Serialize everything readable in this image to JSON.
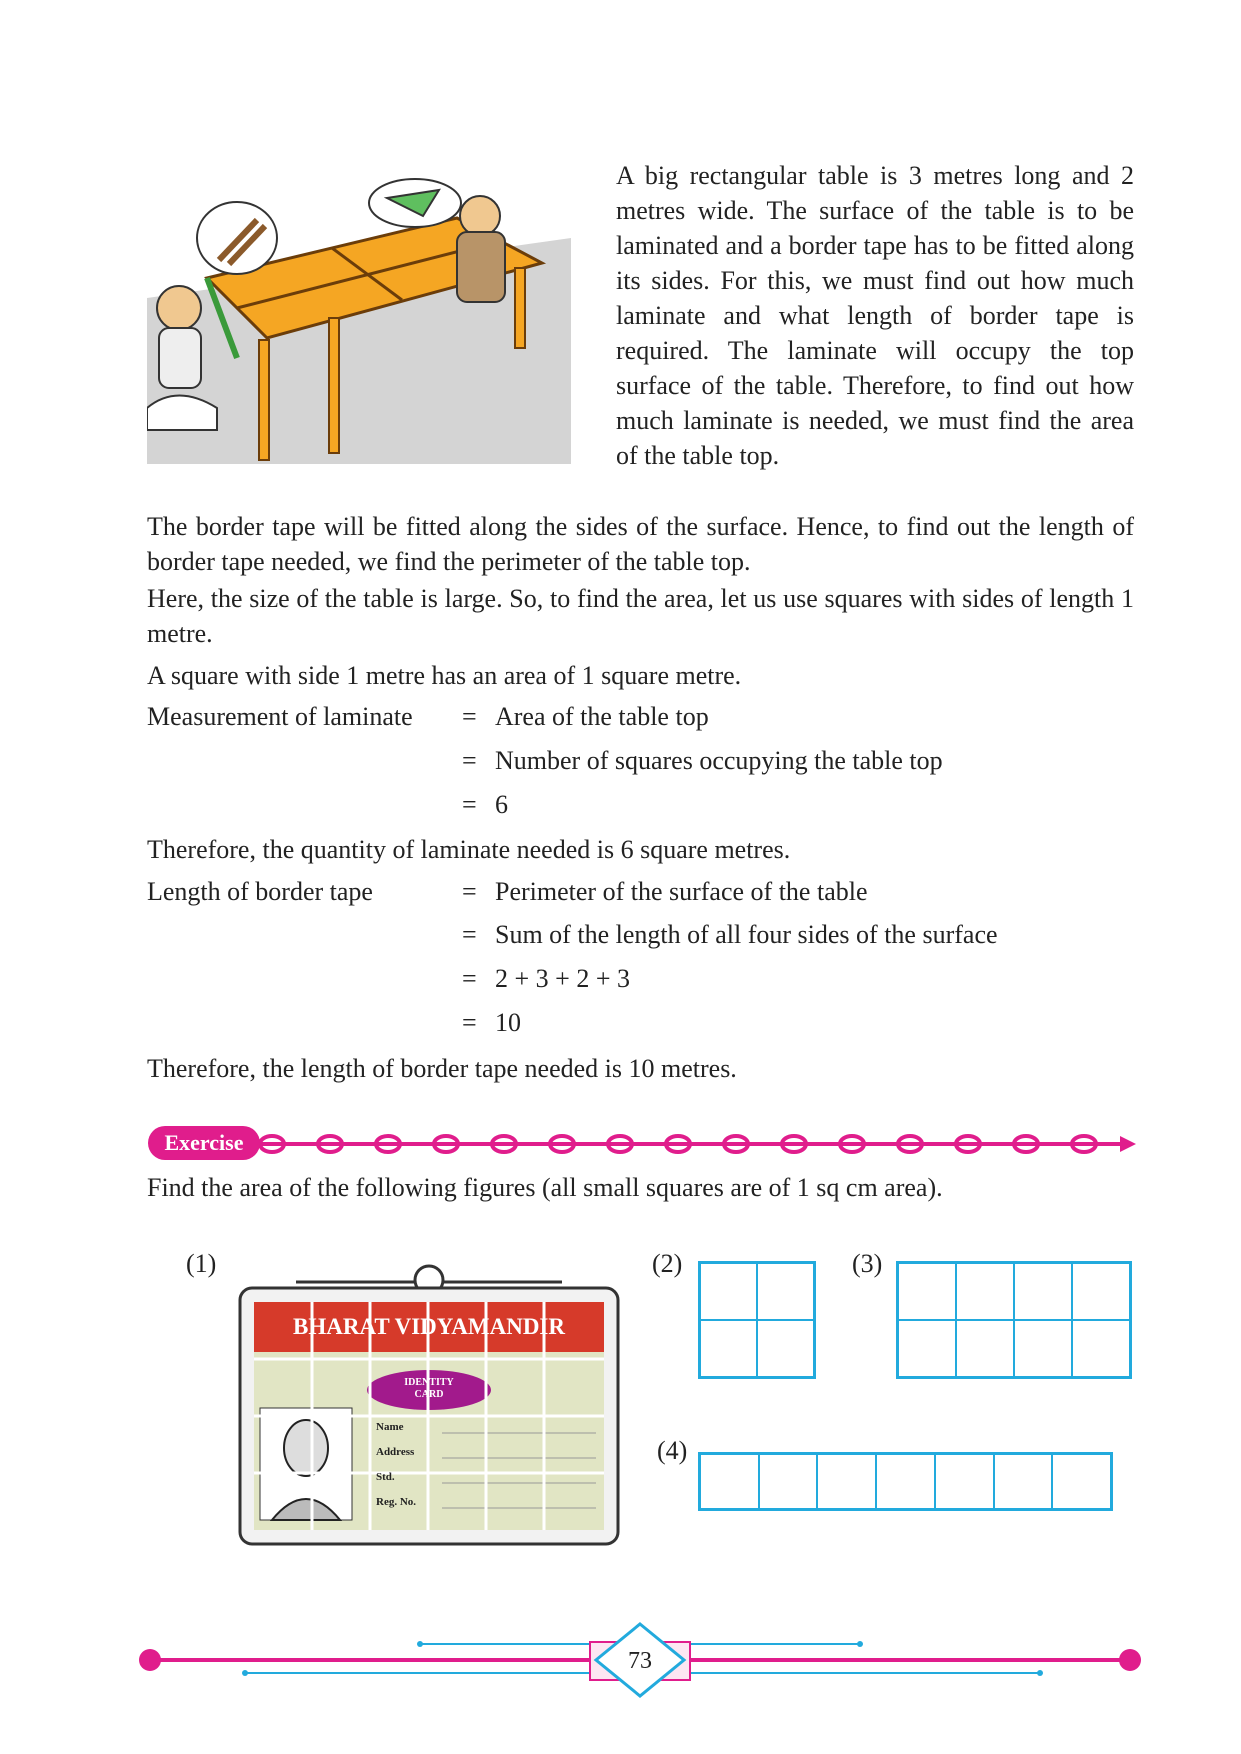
{
  "intro_paragraph": "A big rectangular table is 3 metres long and 2 metres wide. The surface of the table is to be laminated and a border tape has to be fitted along its sides. For this, we must find out how much laminate and what length of border tape is required. The laminate will occupy the top surface of the table. Therefore, to find out how much laminate is needed, we must find the area of the table top.",
  "paragraph_2": "The border tape will be fitted along the sides of the surface. Hence, to find out the length of border tape needed, we find the perimeter of the table top.",
  "paragraph_3": "Here, the size of the table is large. So, to find the area, let us use squares with sides of length 1 metre.",
  "paragraph_4": "A square with side 1 metre has an area of 1 square metre.",
  "laminate_calc": {
    "label": "Measurement of laminate",
    "steps": [
      "Area of the table top",
      "Number of squares occupying the table top",
      "6"
    ]
  },
  "laminate_conclusion": "Therefore, the quantity of laminate needed is 6 square metres.",
  "tape_calc": {
    "label": "Length of border tape",
    "steps": [
      "Perimeter of the surface of the table",
      "Sum of the length of all four sides of the surface",
      "2 + 3 + 2 + 3",
      "10"
    ]
  },
  "tape_conclusion": "Therefore, the length of border tape needed is 10 metres.",
  "equals_sign": "=",
  "exercise": {
    "tag": "Exercise",
    "instruction": "Find the area of the following figures (all small squares are of 1 sq cm area).",
    "figure_labels": [
      "(1)",
      "(2)",
      "(3)",
      "(4)"
    ]
  },
  "id_card": {
    "school": "BHARAT VIDYAMANDIR",
    "badge": "IDENTITY CARD",
    "fields": [
      "Name",
      "Address",
      "Std.",
      "Reg. No."
    ]
  },
  "page_number": "73",
  "colors": {
    "accent": "#e01d8c",
    "grid": "#22aadd",
    "table": "#f5a623"
  }
}
